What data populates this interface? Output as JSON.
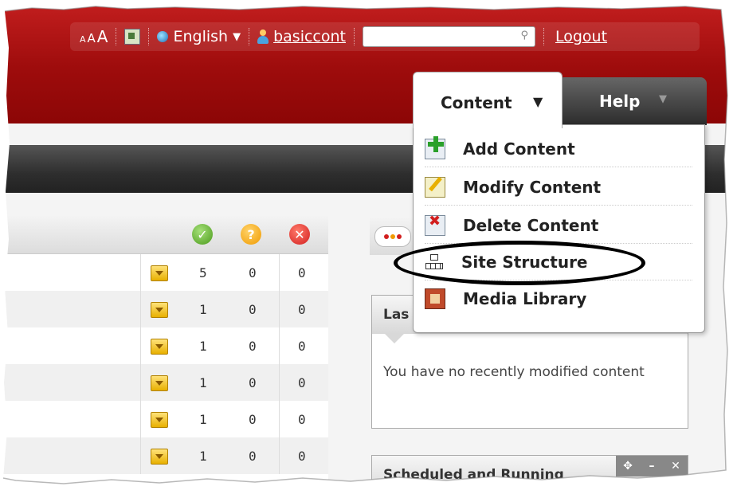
{
  "topbar": {
    "font_size": [
      "A",
      "A",
      "A"
    ],
    "language": "English",
    "language_caret": "▼",
    "username": "basiccont",
    "search_placeholder": "",
    "search_glyph": "⚲",
    "logout": "Logout"
  },
  "nav": {
    "content_tab": "Content",
    "content_caret": "▼",
    "help_tab": "Help",
    "help_caret": "▼",
    "menu": [
      {
        "label": "Add Content",
        "icon": "add-content-icon"
      },
      {
        "label": "Modify Content",
        "icon": "modify-content-icon"
      },
      {
        "label": "Delete Content",
        "icon": "delete-content-icon"
      },
      {
        "label": "Site Structure",
        "icon": "site-structure-icon"
      },
      {
        "label": "Media Library",
        "icon": "media-library-icon"
      }
    ]
  },
  "status_icons": {
    "ok": "✓",
    "question": "?",
    "error": "✕"
  },
  "rows": [
    {
      "c1": "5",
      "c2": "0",
      "c3": "0"
    },
    {
      "c1": "1",
      "c2": "0",
      "c3": "0"
    },
    {
      "c1": "1",
      "c2": "0",
      "c3": "0"
    },
    {
      "c1": "1",
      "c2": "0",
      "c3": "0"
    },
    {
      "c1": "1",
      "c2": "0",
      "c3": "0"
    },
    {
      "c1": "1",
      "c2": "0",
      "c3": "0"
    }
  ],
  "last_modified": {
    "title": "Las",
    "message": "You have no recently modified content"
  },
  "scheduled": {
    "title": "Scheduled and Running",
    "move": "✥",
    "minimize": "–",
    "close": "✕"
  },
  "colors": {
    "header_red": "#a80f0f",
    "dark_bar": "#2e2e2e",
    "ok_green": "#4a9a1a",
    "warn_orange": "#f09a00",
    "error_red": "#d21f1f",
    "annotation": "#000000"
  }
}
